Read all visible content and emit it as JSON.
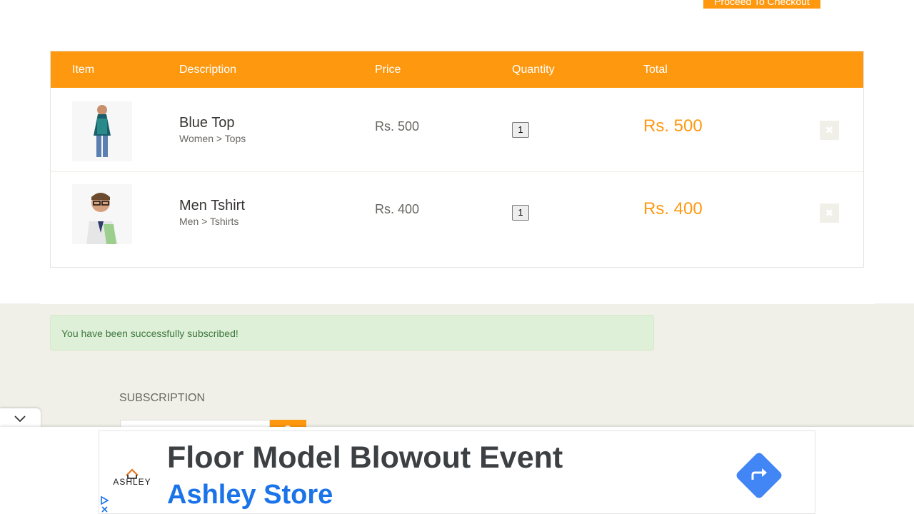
{
  "checkout": {
    "label": "Proceed To Checkout"
  },
  "cart": {
    "headers": [
      "Item",
      "Description",
      "Price",
      "Quantity",
      "Total"
    ],
    "rows": [
      {
        "name": "Blue Top",
        "category": "Women > Tops",
        "price": "Rs. 500",
        "quantity": "1",
        "total": "Rs. 500"
      },
      {
        "name": "Men Tshirt",
        "category": "Men > Tshirts",
        "price": "Rs. 400",
        "quantity": "1",
        "total": "Rs. 400"
      }
    ]
  },
  "footer": {
    "alert": "You have been successfully subscribed!",
    "subscription_title": "SUBSCRIPTION",
    "subscription_placeholder": ""
  },
  "ad": {
    "brand": "ASHLEY",
    "headline": "Floor Model Blowout Event",
    "subline": "Ashley Store"
  },
  "colors": {
    "accent": "#FE980F",
    "alert_bg": "#DFF0D8",
    "alert_text": "#3C763D",
    "footer_bg": "#F0F0E9",
    "ad_blue": "#1a73e8"
  }
}
